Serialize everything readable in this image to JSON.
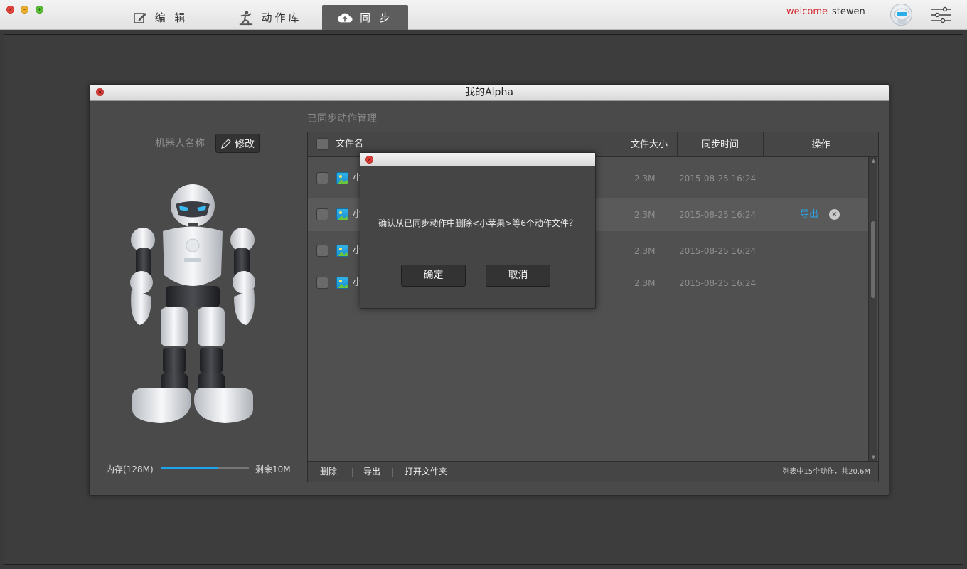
{
  "topbar": {
    "tabs": [
      {
        "label": "编 辑",
        "icon": "edit-icon"
      },
      {
        "label": "动作库",
        "icon": "action-library-icon"
      },
      {
        "label": "同 步",
        "icon": "cloud-sync-icon"
      }
    ],
    "welcome": "welcome",
    "username": "stewen"
  },
  "window": {
    "title": "我的Alpha",
    "robot_name_label": "机器人名称",
    "modify_label": "修改",
    "memory_label": "内存(128M)",
    "memory_used_fraction": 0.65,
    "remaining_label": "剩余10M"
  },
  "sync": {
    "section_title": "已同步动作管理",
    "columns": [
      "文件名",
      "文件大小",
      "同步时间",
      "操作"
    ],
    "rows": [
      {
        "name": "小",
        "size": "2.3M",
        "time": "2015-08-25  16:24",
        "highlighted": false
      },
      {
        "name": "小",
        "size": "2.3M",
        "time": "2015-08-25  16:24",
        "highlighted": true,
        "export_label": "导出"
      },
      {
        "name": "小",
        "size": "2.3M",
        "time": "2015-08-25  16:24",
        "highlighted": false
      },
      {
        "name": "小",
        "size": "2.3M",
        "time": "2015-08-25  16:24",
        "highlighted": false
      }
    ],
    "footer": {
      "delete_label": "删除",
      "export_label": "导出",
      "open_folder_label": "打开文件夹",
      "stats": "列表中15个动作，共20.6M"
    }
  },
  "dialog": {
    "message": "确认从已同步动作中删除<小苹果>等6个动作文件？",
    "confirm_label": "确定",
    "cancel_label": "取消"
  },
  "colors": {
    "accent_blue": "#1fa3ec",
    "welcome_red": "#d3262d"
  }
}
